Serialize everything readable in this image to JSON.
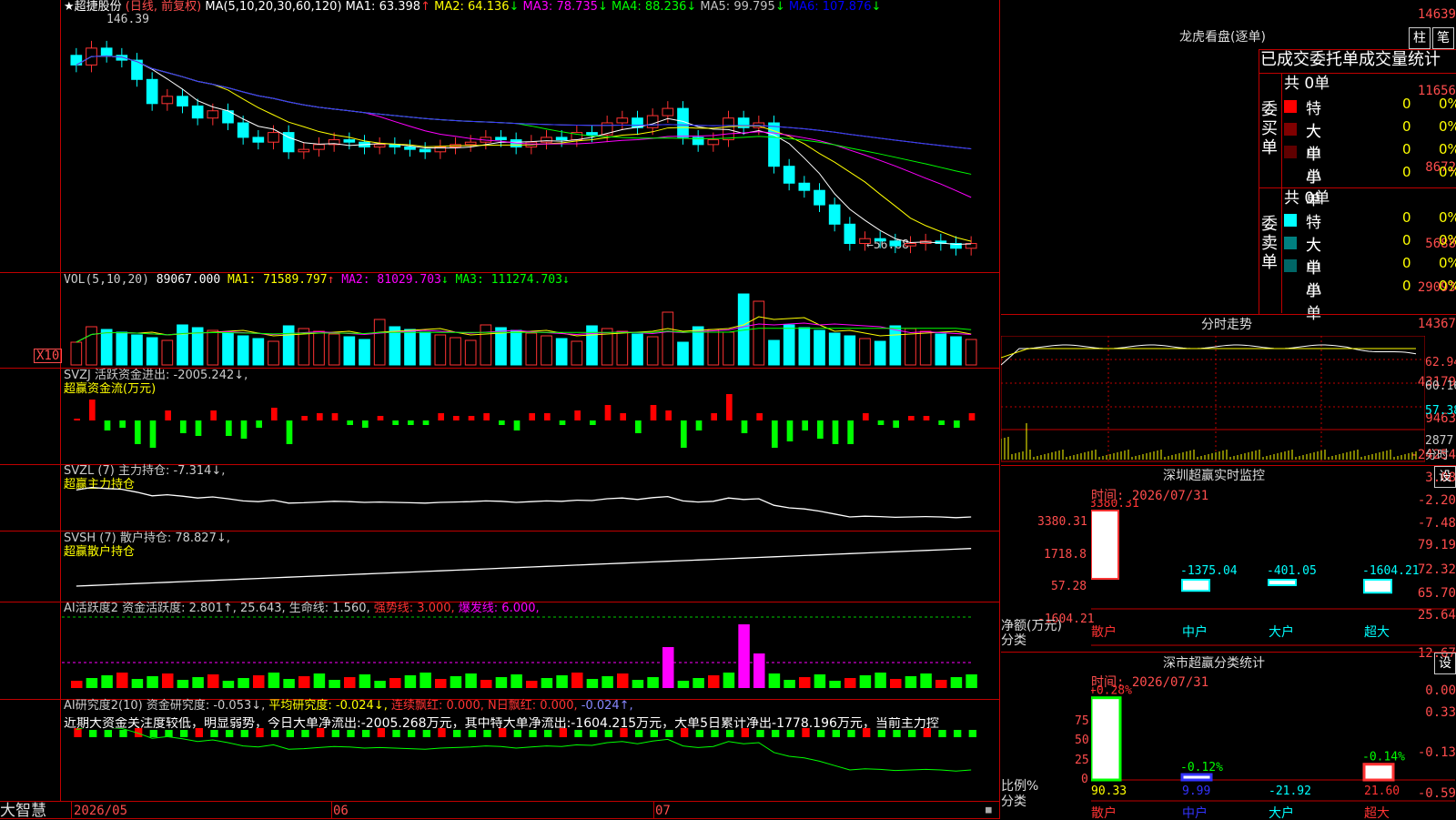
{
  "main": {
    "stock_title": "★超捷股份",
    "period": "(日线, 前复权)",
    "ma_label": "MA(5,10,20,30,60,120)",
    "ma_values": [
      {
        "label": "MA1:",
        "value": "63.398",
        "arrow": "↑",
        "color": "#ffffff"
      },
      {
        "label": "MA2:",
        "value": "64.136",
        "arrow": "↓",
        "color": "#ffff00"
      },
      {
        "label": "MA3:",
        "value": "78.735",
        "arrow": "↓",
        "color": "#ff00ff"
      },
      {
        "label": "MA4:",
        "value": "88.236",
        "arrow": "↓",
        "color": "#00ff00"
      },
      {
        "label": "MA5:",
        "value": "99.795",
        "arrow": "↓",
        "color": "#c0c0c0"
      },
      {
        "label": "MA6:",
        "value": "107.876",
        "arrow": "↓",
        "color": "#0000ff"
      }
    ],
    "y_ticks": [
      "14639",
      "11656",
      "8672",
      "5688"
    ],
    "high_label": "146.39",
    "low_label": "←56.88"
  },
  "vol": {
    "label": "VOL(5,10,20)",
    "value": "89067.000",
    "ma_values": [
      {
        "label": "MA1:",
        "value": "71589.797",
        "arrow": "↑",
        "color": "#ffff00"
      },
      {
        "label": "MA2:",
        "value": "81029.703",
        "arrow": "↓",
        "color": "#ff00ff"
      },
      {
        "label": "MA3:",
        "value": "111274.703",
        "arrow": "↓",
        "color": "#00ff00"
      }
    ],
    "y_ticks": [
      "29093",
      "14367"
    ],
    "unit": "X10"
  },
  "svzj": {
    "label": "SVZJ  活跃资金进出: -2005.242↓,",
    "sub": "超赢资金流(万元)",
    "y_ticks": [
      "43179",
      "9463",
      "-24254"
    ]
  },
  "svzl": {
    "label": "SVZL (7) 主力持仓: -7.314↓,",
    "sub": "超赢主力持仓",
    "y_ticks": [
      "3.08",
      "-2.20",
      "-7.48"
    ]
  },
  "svsh": {
    "label": "SVSH (7) 散户持仓: 78.827↓,",
    "sub": "超赢散户持仓",
    "y_ticks": [
      "79.19",
      "72.32",
      "65.70"
    ]
  },
  "ai1": {
    "label": "AI活跃度2 资金活跃度: 2.801↑, 25.643, 生命线: 1.560,",
    "strong": "强势线: 3.000,",
    "burst": "爆发线: 6.000,",
    "y_ticks": [
      "25.64",
      "12.67",
      "0.00"
    ]
  },
  "ai2": {
    "label": "AI研究度2(10) 资金研究度: -0.053↓,",
    "avg": "平均研究度: -0.024↓,",
    "red1": "连续飘红: 0.000,",
    "red2": "N日飘红: 0.000,",
    "last": "-0.024↑,",
    "commentary": "近期大资金关注度较低，明显弱势，今日大单净流出:-2005.268万元，其中特大单净流出:-1604.215万元，大单5日累计净出-1778.196万元，当前主力控",
    "y_ticks": [
      "0.33",
      "-0.13",
      "-0.59"
    ]
  },
  "footer": {
    "brand": "大智慧",
    "dates": [
      "2026/05",
      "06",
      "07"
    ]
  },
  "right": {
    "dragon_title": "龙虎看盘(逐单)",
    "tab1": "柱",
    "tab2": "笔",
    "stats_header": "已成交委托单成交量统计",
    "buy_label": "委买单",
    "sell_label": "委卖单",
    "buy_total": "共 0单",
    "sell_total": "共 0单",
    "buy_rows": [
      {
        "name": "特大",
        "count": "0",
        "pct": "0%",
        "color": "#ff0000"
      },
      {
        "name": "大单",
        "count": "0",
        "pct": "0%",
        "color": "#800000"
      },
      {
        "name": "中单",
        "count": "0",
        "pct": "0%",
        "color": "#600000"
      },
      {
        "name": "小单",
        "count": "0",
        "pct": "0%",
        "color": "#000000"
      }
    ],
    "sell_rows": [
      {
        "name": "特大",
        "count": "0",
        "pct": "0%",
        "color": "#00ffff"
      },
      {
        "name": "大单",
        "count": "0",
        "pct": "0%",
        "color": "#008080"
      },
      {
        "name": "中单",
        "count": "0",
        "pct": "0%",
        "color": "#006666"
      },
      {
        "name": "小单",
        "count": "0",
        "pct": "0%",
        "color": "#000000"
      }
    ],
    "intraday_title": "分时走势",
    "intraday_y": [
      "62.94",
      "60.16",
      "57.38",
      "2877",
      "分时"
    ],
    "monitor_title": "深圳超赢实时监控",
    "monitor_set": "设",
    "monitor_time": "时间: 2026/07/31",
    "monitor_y": [
      "3380.31",
      "1718.8",
      "57.28",
      "-1604.21"
    ],
    "monitor_axis_title": "净额(万元)",
    "monitor_axis_sub": "分类",
    "monitor_bars": [
      {
        "cat": "散户",
        "value": "3380.31"
      },
      {
        "cat": "中户",
        "value": "-1375.04"
      },
      {
        "cat": "大户",
        "value": "-401.05"
      },
      {
        "cat": "超大",
        "value": "-1604.21"
      }
    ],
    "class_title": "深市超赢分类统计",
    "class_set": "设",
    "class_time": "时间: 2026/07/31",
    "class_y": [
      "75",
      "50",
      "25",
      "0"
    ],
    "class_axis_title": "比例%",
    "class_axis_sub": "分类",
    "class_bars": [
      {
        "cat": "散户",
        "top": "+0.28%",
        "bottom": "90.33"
      },
      {
        "cat": "中户",
        "top": "-0.12%",
        "bottom": "9.99"
      },
      {
        "cat": "大户",
        "top": "",
        "bottom": "-21.92"
      },
      {
        "cat": "超大",
        "top": "-0.14%",
        "bottom": "21.60"
      }
    ]
  },
  "chart_data": {
    "type": "candlestick",
    "title": "超捷股份 (日线, 前复权)",
    "x_range": [
      "2026/05",
      "2026/07/31"
    ],
    "y_range": [
      5688,
      14639
    ],
    "high": 146.39,
    "low": 56.88,
    "close": [
      134,
      141,
      138,
      136,
      128,
      118,
      121,
      117,
      112,
      115,
      110,
      104,
      102,
      106,
      98,
      99,
      101,
      103,
      102,
      100,
      101,
      100,
      99,
      98,
      100,
      101,
      102,
      104,
      103,
      100,
      102,
      104,
      103,
      106,
      105,
      110,
      112,
      108,
      113,
      116,
      104,
      101,
      103,
      112,
      108,
      110,
      92,
      85,
      82,
      76,
      68,
      60,
      62,
      61,
      59,
      60,
      61,
      60,
      58,
      60
    ]
  }
}
